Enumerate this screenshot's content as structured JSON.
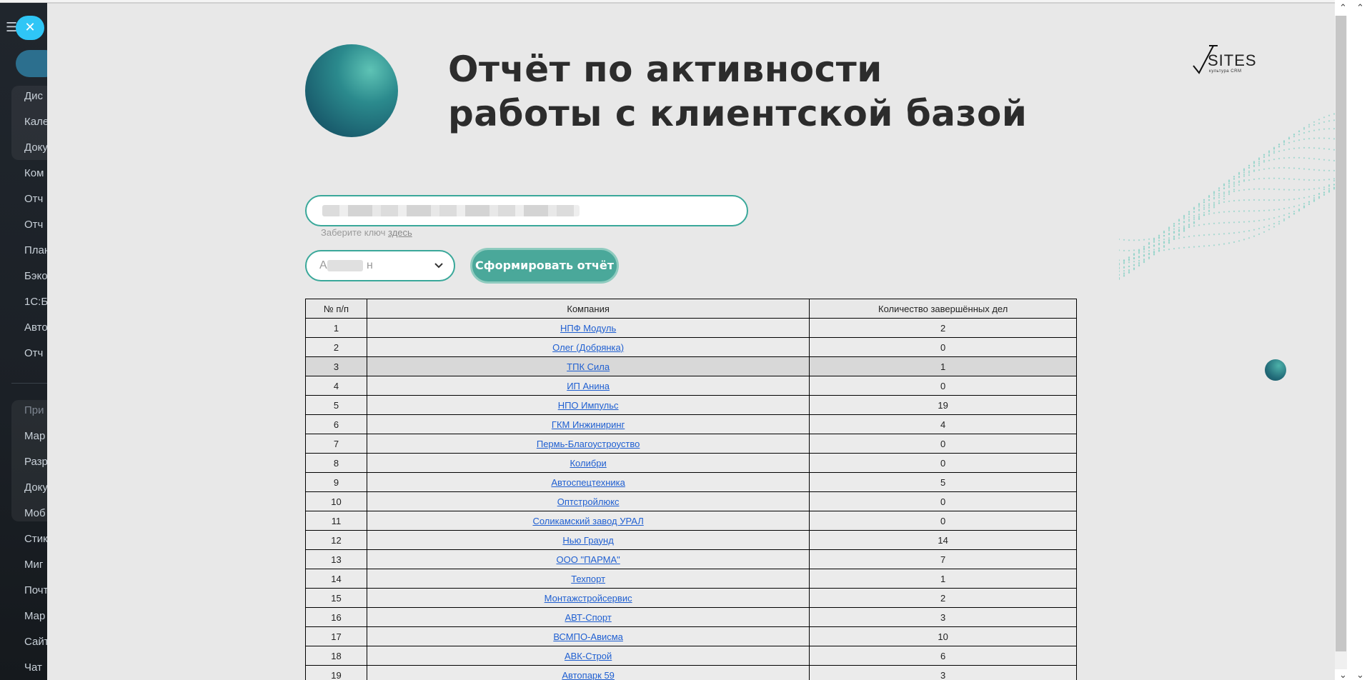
{
  "background_sidebar": {
    "items": [
      "Дис",
      "Кале",
      "Доку",
      "Ком",
      "Отч",
      "Отч",
      "План",
      "Бэко",
      "1С:Б",
      "Авто",
      "Отч",
      "При",
      "Мар",
      "Разр",
      "Доку",
      "Моб",
      "Стик",
      "Миг",
      "Почт",
      "Мар",
      "Сайт",
      "Чат"
    ]
  },
  "close_button": {
    "symbol": "✕"
  },
  "header": {
    "title_line1": "Отчёт по активности",
    "title_line2": "работы с клиентской базой"
  },
  "logo": {
    "text": "SITES",
    "subtext": "культура CRM"
  },
  "key_form": {
    "input_value": "",
    "hint_prefix": "Заберите ключ ",
    "hint_link": "здесь"
  },
  "manager_select": {
    "selected_prefix": "А",
    "selected_suffix": "н"
  },
  "generate_button": {
    "label": "Сформировать отчёт"
  },
  "table": {
    "headers": [
      "№ п/п",
      "Компания",
      "Количество завершённых дел"
    ],
    "rows": [
      {
        "n": "1",
        "company": "НПФ Модуль",
        "done": "2"
      },
      {
        "n": "2",
        "company": "Олег (Добрянка)",
        "done": "0"
      },
      {
        "n": "3",
        "company": "ТПК Сила",
        "done": "1"
      },
      {
        "n": "4",
        "company": "ИП Анина",
        "done": "0"
      },
      {
        "n": "5",
        "company": "НПО Импульс",
        "done": "19"
      },
      {
        "n": "6",
        "company": "ГКМ Инжиниринг",
        "done": "4"
      },
      {
        "n": "7",
        "company": "Пермь-Благоустроуство",
        "done": "0"
      },
      {
        "n": "8",
        "company": "Колибри",
        "done": "0"
      },
      {
        "n": "9",
        "company": "Автоспецтехника",
        "done": "5"
      },
      {
        "n": "10",
        "company": "Оптстройлюкс",
        "done": "0"
      },
      {
        "n": "11",
        "company": "Соликамский завод УРАЛ",
        "done": "0"
      },
      {
        "n": "12",
        "company": "Нью Граунд",
        "done": "14"
      },
      {
        "n": "13",
        "company": "ООО \"ПАРМА\"",
        "done": "7"
      },
      {
        "n": "14",
        "company": "Техпорт",
        "done": "1"
      },
      {
        "n": "15",
        "company": "Монтажстройсервис",
        "done": "2"
      },
      {
        "n": "16",
        "company": "АВТ-Спорт",
        "done": "3"
      },
      {
        "n": "17",
        "company": "ВСМПО-Ависма",
        "done": "10"
      },
      {
        "n": "18",
        "company": "АВК-Строй",
        "done": "6"
      },
      {
        "n": "19",
        "company": "Автопарк 59",
        "done": "3"
      }
    ]
  },
  "colors": {
    "accent": "#3aa89a",
    "button": "#4aa89a",
    "link": "#1f5fd1",
    "panel_bg": "#e8e8e8"
  }
}
